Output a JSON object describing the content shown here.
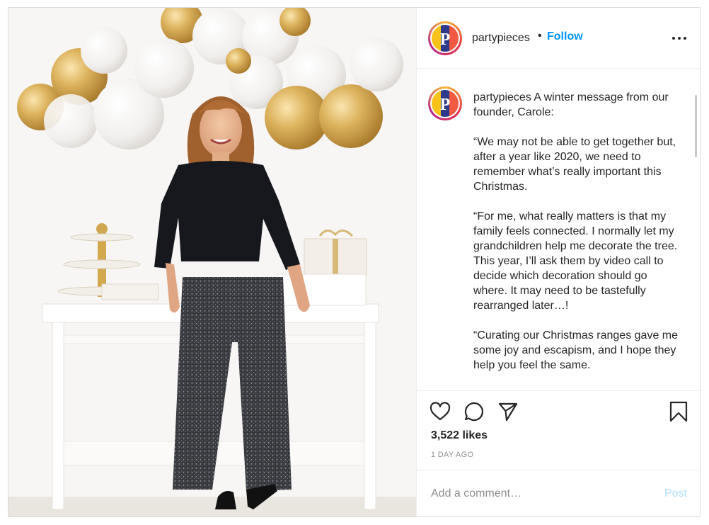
{
  "post": {
    "photo": {
      "alt_icon": "photo-of-woman-with-balloons"
    },
    "author": {
      "username": "partypieces",
      "separator": "•",
      "follow_label": "Follow",
      "avatar_letter": "P",
      "avatar_colors": [
        "#f7c21a",
        "#f05a42",
        "#2d3a8c"
      ]
    },
    "more_icon": "more-horizontal-icon",
    "caption": {
      "author": "partypieces",
      "intro": "A winter message from our founder, Carole:",
      "paragraphs": [
        "“We may not be able to get together but, after a year like 2020, we need to remember what’s really important this Christmas.",
        "“For me, what really matters is that my family feels connected. I normally let my grandchildren help me decorate the tree. This year, I’ll ask them by video call to decide which decoration should go where. It may need to be tastefully rearranged later…!",
        "“Curating our Christmas ranges gave me some joy and escapism, and I hope they help you feel the same."
      ]
    },
    "actions": {
      "like_icon": "heart-icon",
      "comment_icon": "comment-icon",
      "share_icon": "share-icon",
      "save_icon": "bookmark-icon"
    },
    "likes": "3,522 likes",
    "timestamp": "1 DAY AGO",
    "comment_box": {
      "placeholder": "Add a comment…",
      "post_label": "Post"
    },
    "colors": {
      "link_blue": "#0095f6",
      "post_disabled": "#b2dffc",
      "muted": "#8e8e8e"
    }
  }
}
